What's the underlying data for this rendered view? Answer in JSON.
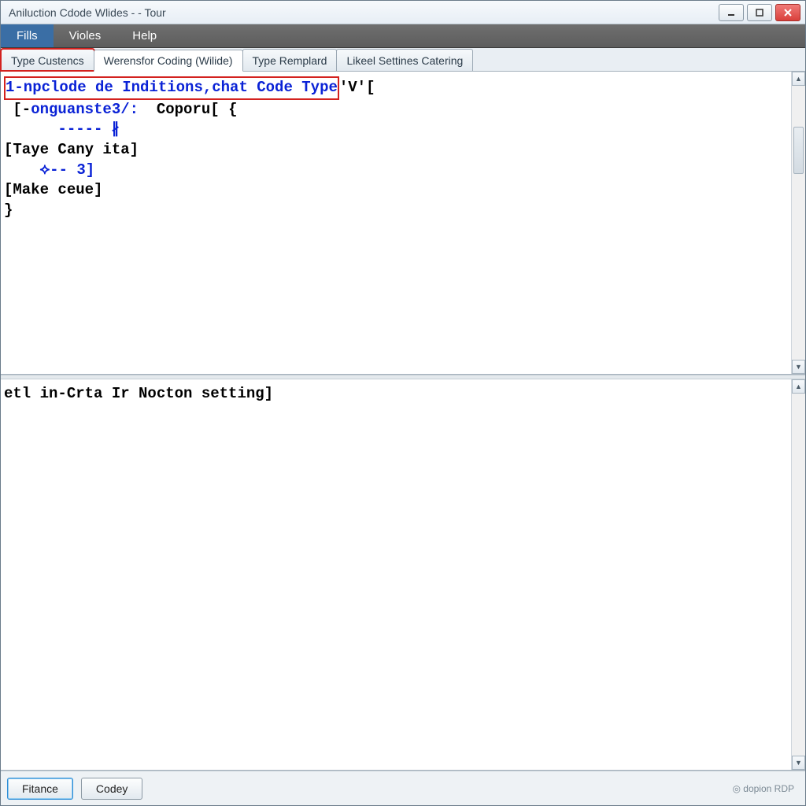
{
  "titlebar": {
    "title": "Aniluction Cdode Wlides - - Tour"
  },
  "menu": {
    "fills": "Fills",
    "violes": "Violes",
    "help": "Help"
  },
  "tabs": [
    {
      "label": "Type Custencs"
    },
    {
      "label": "Werensfor Coding (Wilide)"
    },
    {
      "label": "Type Remplard"
    },
    {
      "label": "Likeel Settines Catering"
    }
  ],
  "code": {
    "l1_kw": "1-npclode de Inditions,chat Code Type",
    "l1_tail": "'V'[",
    "l2a": "[-",
    "l2b": "onguanste3/:",
    "l2c": "  Coporu[ {",
    "l3": "      ----- ∦",
    "l4": "[Taye Cany ita]",
    "l5": "    ⟡-- 3]",
    "l6": "[Make ceue]",
    "l7": "}"
  },
  "lower": {
    "l1": "etl in-Crta Ir Nocton setting]"
  },
  "buttons": {
    "fitance": "Fitance",
    "codey": "Codey"
  },
  "status": {
    "right": "◎ dopion RDP"
  }
}
